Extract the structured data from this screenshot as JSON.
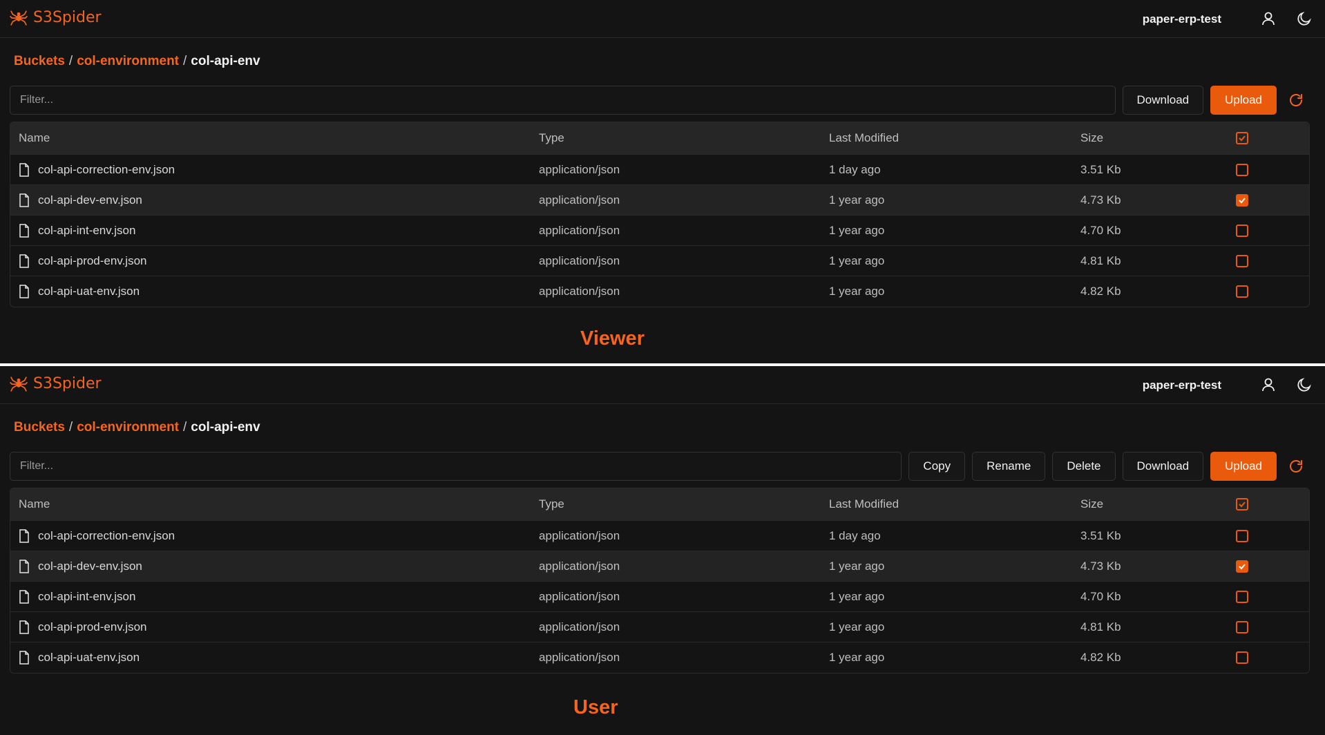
{
  "app": {
    "name": "S3Spider",
    "accent_color": "#ea5a0c",
    "account": "paper-erp-test",
    "icons": {
      "logo": "spider-icon",
      "user": "user-icon",
      "theme": "moon-icon",
      "refresh": "refresh-icon",
      "file": "file-icon"
    }
  },
  "breadcrumb": {
    "root": "Buckets",
    "bucket": "col-environment",
    "current": "col-api-env",
    "separator": "/"
  },
  "filter": {
    "placeholder": "Filter..."
  },
  "actions": {
    "copy": "Copy",
    "rename": "Rename",
    "delete": "Delete",
    "download": "Download",
    "upload": "Upload"
  },
  "table": {
    "columns": {
      "name": "Name",
      "type": "Type",
      "modified": "Last Modified",
      "size": "Size"
    },
    "rows": [
      {
        "name": "col-api-correction-env.json",
        "type": "application/json",
        "modified": "1 day ago",
        "size": "3.51 Kb",
        "selected": false
      },
      {
        "name": "col-api-dev-env.json",
        "type": "application/json",
        "modified": "1 year ago",
        "size": "4.73 Kb",
        "selected": true
      },
      {
        "name": "col-api-int-env.json",
        "type": "application/json",
        "modified": "1 year ago",
        "size": "4.70 Kb",
        "selected": false
      },
      {
        "name": "col-api-prod-env.json",
        "type": "application/json",
        "modified": "1 year ago",
        "size": "4.81 Kb",
        "selected": false
      },
      {
        "name": "col-api-uat-env.json",
        "type": "application/json",
        "modified": "1 year ago",
        "size": "4.82 Kb",
        "selected": false
      }
    ]
  },
  "panels": {
    "viewer": {
      "label": "Viewer"
    },
    "user": {
      "label": "User"
    }
  }
}
